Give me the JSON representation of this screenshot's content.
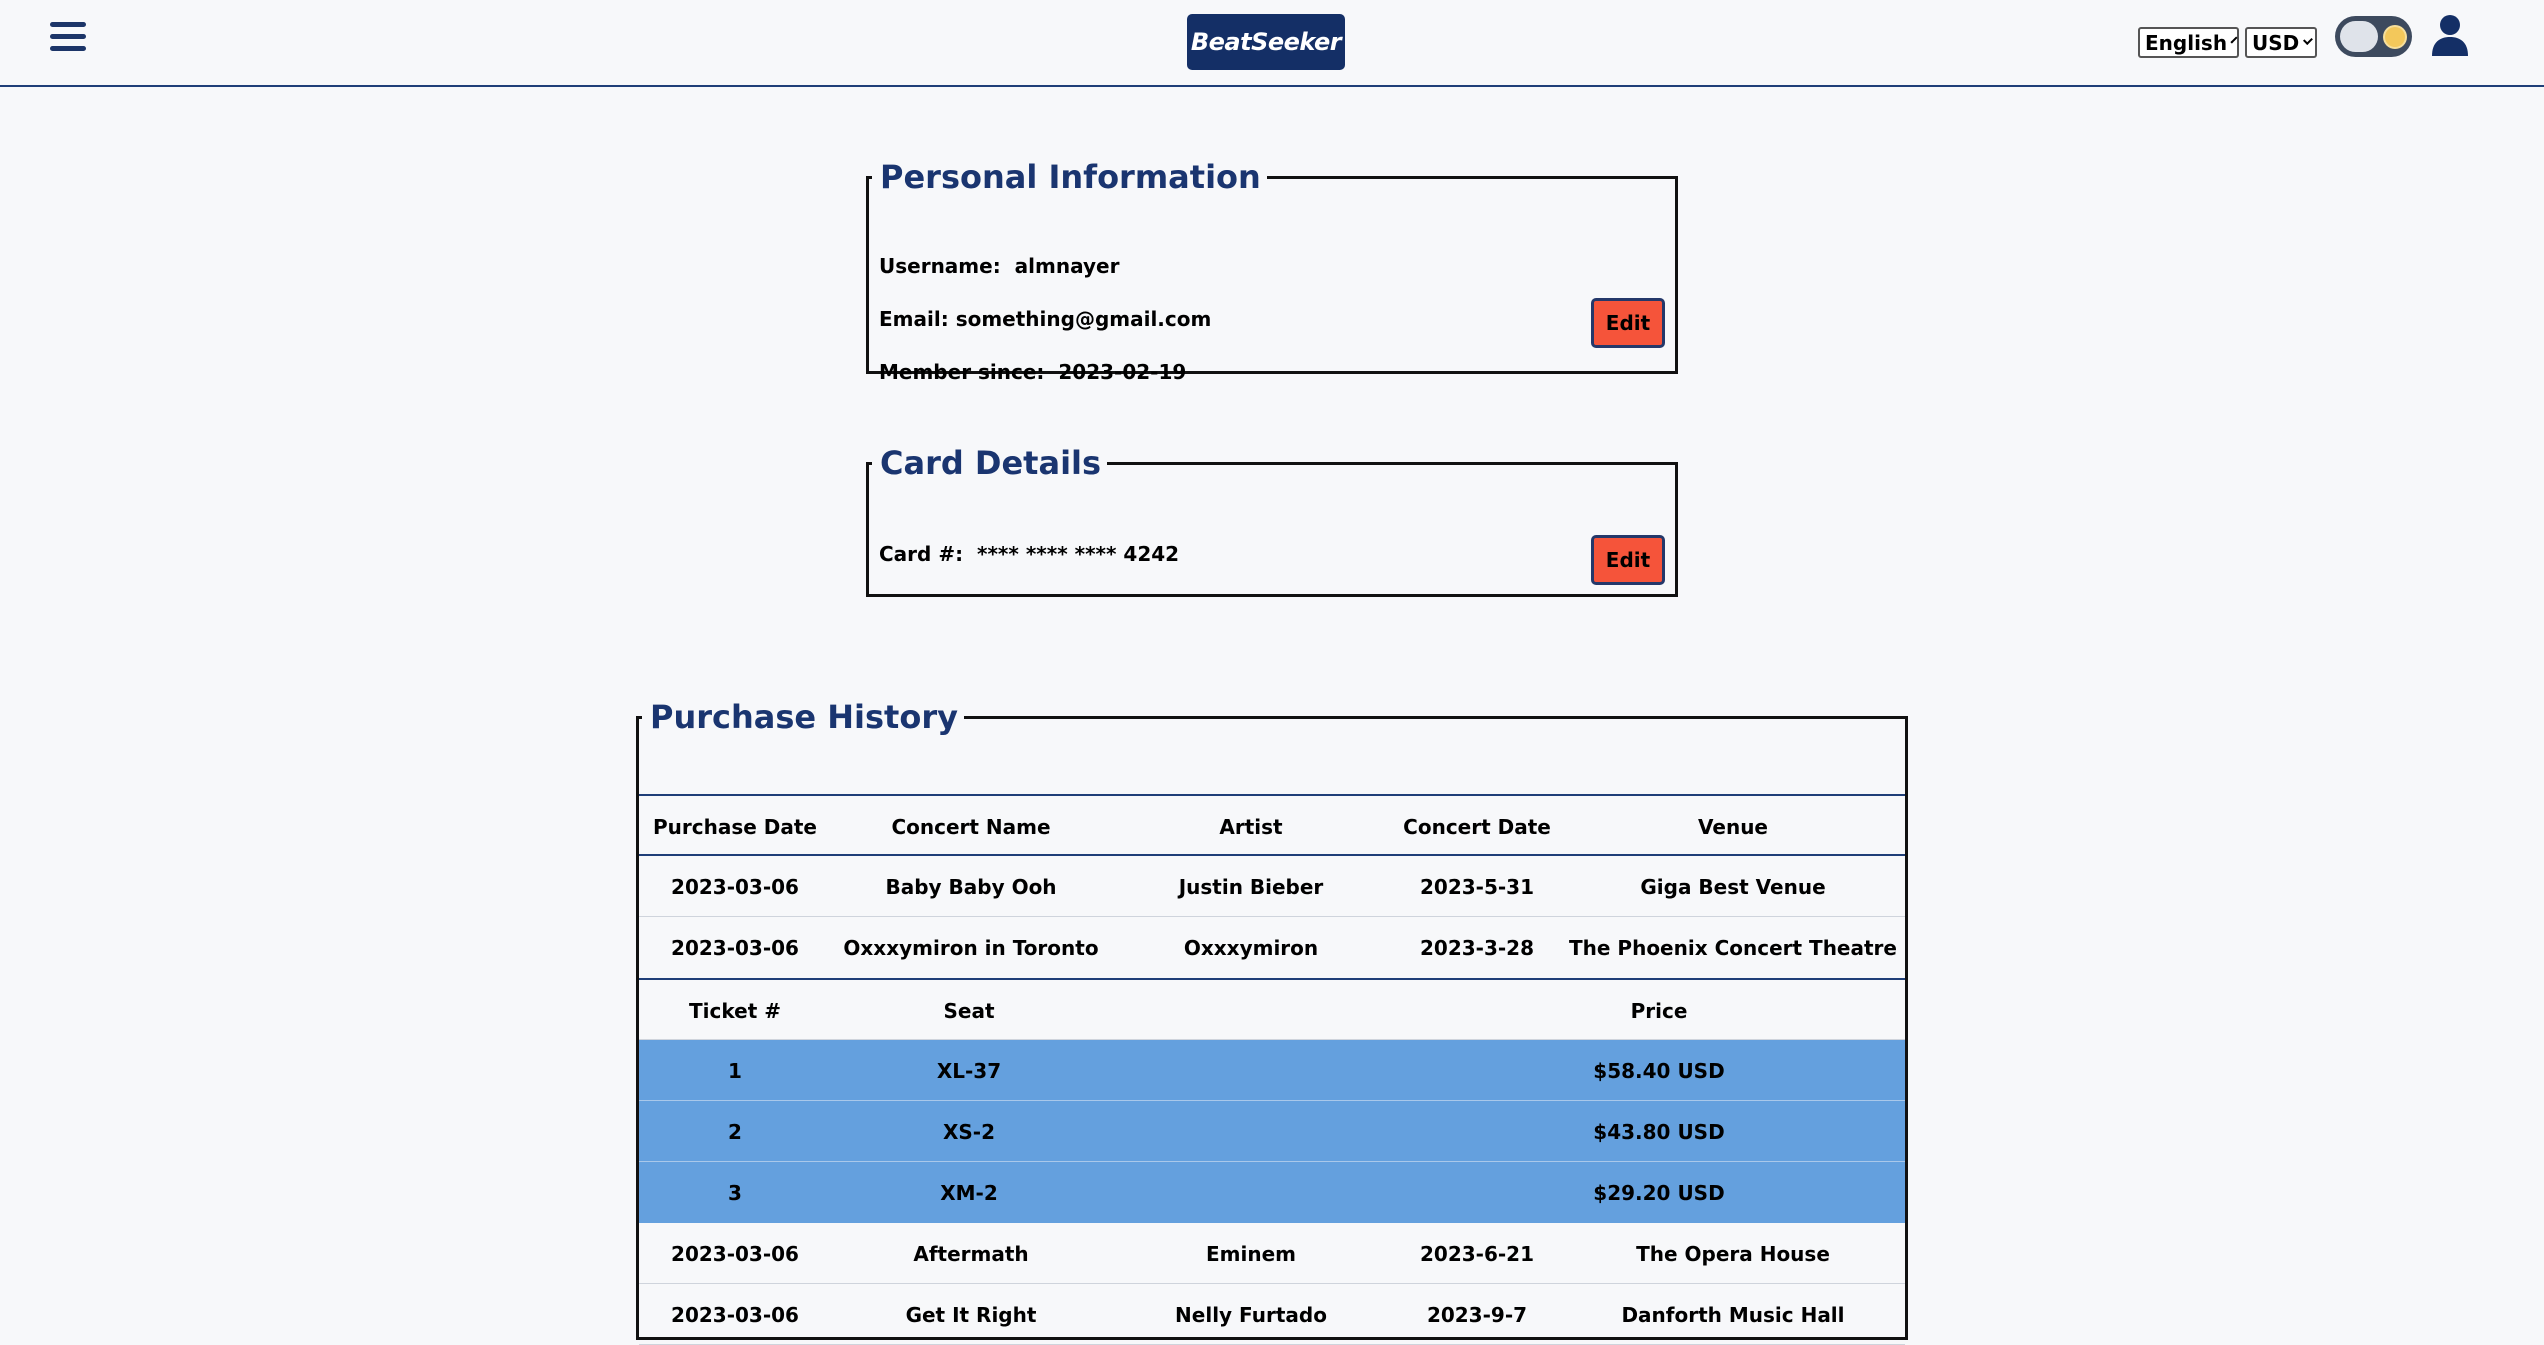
{
  "header": {
    "logo": "BeatSeeker",
    "language": "English",
    "currency": "USD",
    "icons": {
      "menu": "hamburger-menu-icon",
      "theme": "theme-toggle-icon",
      "user": "user-icon"
    }
  },
  "personal": {
    "title": "Personal Information",
    "username_label": "Username:",
    "username": "almnayer",
    "email_label": "Email:",
    "email": "something@gmail.com",
    "member_label": "Member since:",
    "member_since": "2023-02-19",
    "edit_label": "Edit"
  },
  "card": {
    "title": "Card Details",
    "card_label": "Card #:",
    "card_number": "**** **** **** 4242",
    "edit_label": "Edit"
  },
  "history": {
    "title": "Purchase History",
    "columns": [
      "Purchase Date",
      "Concert Name",
      "Artist",
      "Concert Date",
      "Venue"
    ],
    "rows": [
      [
        "2023-03-06",
        "Baby Baby Ooh",
        "Justin Bieber",
        "2023-5-31",
        "Giga Best Venue"
      ],
      [
        "2023-03-06",
        "Oxxxymiron in Toronto",
        "Oxxxymiron",
        "2023-3-28",
        "The Phoenix Concert Theatre"
      ],
      [
        "2023-03-06",
        "Aftermath",
        "Eminem",
        "2023-6-21",
        "The Opera House"
      ],
      [
        "2023-03-06",
        "Get It Right",
        "Nelly Furtado",
        "2023-9-7",
        "Danforth Music Hall"
      ]
    ],
    "ticket_columns": [
      "Ticket #",
      "Seat",
      "Price"
    ],
    "tickets": [
      [
        "1",
        "XL-37",
        "$58.40 USD"
      ],
      [
        "2",
        "XS-2",
        "$43.80 USD"
      ],
      [
        "3",
        "XM-2",
        "$29.20 USD"
      ]
    ]
  },
  "colors": {
    "brand": "#142f66",
    "accent_button": "#f5543a",
    "ticket_highlight": "#64a0de"
  }
}
